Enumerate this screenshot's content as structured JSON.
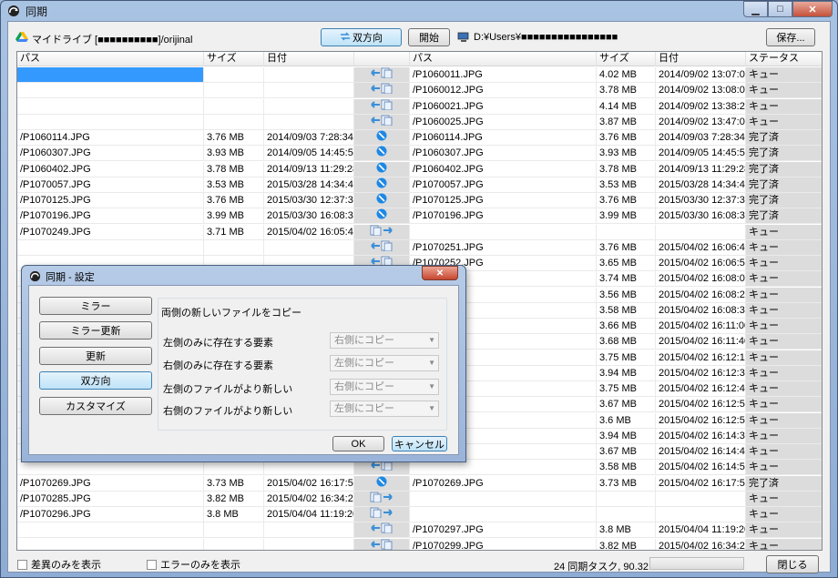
{
  "window": {
    "title": "同期",
    "min_label": "▁",
    "max_label": "□",
    "close_label": "✕"
  },
  "toolbar": {
    "left_path": "マイドライブ [■■■■■■■■■■]/orijinal",
    "direction_button": "双方向",
    "start_button": "開始",
    "right_path": "D:¥Users¥■■■■■■■■■■■■■■■■",
    "save_button": "保存..."
  },
  "columns": [
    "パス",
    "サイズ",
    "日付",
    "",
    "パス",
    "サイズ",
    "日付",
    "ステータス"
  ],
  "rows": [
    {
      "lp": "",
      "ls": "",
      "ld": "",
      "dir": "left",
      "rp": "/P1060011.JPG",
      "rs": "4.02 MB",
      "rd": "2014/09/02 13:07:02",
      "st": "キュー",
      "sel": true
    },
    {
      "lp": "",
      "ls": "",
      "ld": "",
      "dir": "left",
      "rp": "/P1060012.JPG",
      "rs": "3.78 MB",
      "rd": "2014/09/02 13:08:02",
      "st": "キュー"
    },
    {
      "lp": "",
      "ls": "",
      "ld": "",
      "dir": "left",
      "rp": "/P1060021.JPG",
      "rs": "4.14 MB",
      "rd": "2014/09/02 13:38:26",
      "st": "キュー"
    },
    {
      "lp": "",
      "ls": "",
      "ld": "",
      "dir": "left",
      "rp": "/P1060025.JPG",
      "rs": "3.87 MB",
      "rd": "2014/09/02 13:47:04",
      "st": "キュー"
    },
    {
      "lp": "/P1060114.JPG",
      "ls": "3.76 MB",
      "ld": "2014/09/03 7:28:34",
      "dir": "equal",
      "rp": "/P1060114.JPG",
      "rs": "3.76 MB",
      "rd": "2014/09/03 7:28:34",
      "st": "完了済"
    },
    {
      "lp": "/P1060307.JPG",
      "ls": "3.93 MB",
      "ld": "2014/09/05 14:45:56",
      "dir": "equal",
      "rp": "/P1060307.JPG",
      "rs": "3.93 MB",
      "rd": "2014/09/05 14:45:56",
      "st": "完了済"
    },
    {
      "lp": "/P1060402.JPG",
      "ls": "3.78 MB",
      "ld": "2014/09/13 11:29:28",
      "dir": "equal",
      "rp": "/P1060402.JPG",
      "rs": "3.78 MB",
      "rd": "2014/09/13 11:29:28",
      "st": "完了済"
    },
    {
      "lp": "/P1070057.JPG",
      "ls": "3.53 MB",
      "ld": "2015/03/28 14:34:40",
      "dir": "equal",
      "rp": "/P1070057.JPG",
      "rs": "3.53 MB",
      "rd": "2015/03/28 14:34:40",
      "st": "完了済"
    },
    {
      "lp": "/P1070125.JPG",
      "ls": "3.76 MB",
      "ld": "2015/03/30 12:37:32",
      "dir": "equal",
      "rp": "/P1070125.JPG",
      "rs": "3.76 MB",
      "rd": "2015/03/30 12:37:32",
      "st": "完了済"
    },
    {
      "lp": "/P1070196.JPG",
      "ls": "3.99 MB",
      "ld": "2015/03/30 16:08:30",
      "dir": "equal",
      "rp": "/P1070196.JPG",
      "rs": "3.99 MB",
      "rd": "2015/03/30 16:08:30",
      "st": "完了済"
    },
    {
      "lp": "/P1070249.JPG",
      "ls": "3.71 MB",
      "ld": "2015/04/02 16:05:40",
      "dir": "right",
      "rp": "",
      "rs": "",
      "rd": "",
      "st": "キュー"
    },
    {
      "lp": "",
      "ls": "",
      "ld": "",
      "dir": "left",
      "rp": "/P1070251.JPG",
      "rs": "3.76 MB",
      "rd": "2015/04/02 16:06:48",
      "st": "キュー"
    },
    {
      "lp": "",
      "ls": "",
      "ld": "",
      "dir": "left",
      "rp": "/P1070252.JPG",
      "rs": "3.65 MB",
      "rd": "2015/04/02 16:06:54",
      "st": "キュー"
    },
    {
      "lp": "",
      "ls": "",
      "ld": "",
      "dir": "left",
      "rp": "",
      "rs": "3.74 MB",
      "rd": "2015/04/02 16:08:00",
      "st": "キュー"
    },
    {
      "lp": "",
      "ls": "",
      "ld": "",
      "dir": "left",
      "rp": "",
      "rs": "3.56 MB",
      "rd": "2015/04/02 16:08:28",
      "st": "キュー"
    },
    {
      "lp": "",
      "ls": "",
      "ld": "",
      "dir": "left",
      "rp": "",
      "rs": "3.58 MB",
      "rd": "2015/04/02 16:08:34",
      "st": "キュー"
    },
    {
      "lp": "",
      "ls": "",
      "ld": "",
      "dir": "left",
      "rp": "",
      "rs": "3.66 MB",
      "rd": "2015/04/02 16:11:00",
      "st": "キュー"
    },
    {
      "lp": "",
      "ls": "",
      "ld": "",
      "dir": "left",
      "rp": "",
      "rs": "3.68 MB",
      "rd": "2015/04/02 16:11:40",
      "st": "キュー"
    },
    {
      "lp": "",
      "ls": "",
      "ld": "",
      "dir": "left",
      "rp": "",
      "rs": "3.75 MB",
      "rd": "2015/04/02 16:12:14",
      "st": "キュー"
    },
    {
      "lp": "",
      "ls": "",
      "ld": "",
      "dir": "left",
      "rp": "",
      "rs": "3.94 MB",
      "rd": "2015/04/02 16:12:36",
      "st": "キュー"
    },
    {
      "lp": "",
      "ls": "",
      "ld": "",
      "dir": "left",
      "rp": "",
      "rs": "3.75 MB",
      "rd": "2015/04/02 16:12:44",
      "st": "キュー"
    },
    {
      "lp": "",
      "ls": "",
      "ld": "",
      "dir": "left",
      "rp": "",
      "rs": "3.67 MB",
      "rd": "2015/04/02 16:12:54",
      "st": "キュー"
    },
    {
      "lp": "",
      "ls": "",
      "ld": "",
      "dir": "left",
      "rp": "",
      "rs": "3.6 MB",
      "rd": "2015/04/02 16:12:58",
      "st": "キュー"
    },
    {
      "lp": "",
      "ls": "",
      "ld": "",
      "dir": "left",
      "rp": "",
      "rs": "3.94 MB",
      "rd": "2015/04/02 16:14:34",
      "st": "キュー"
    },
    {
      "lp": "",
      "ls": "",
      "ld": "",
      "dir": "left",
      "rp": "",
      "rs": "3.67 MB",
      "rd": "2015/04/02 16:14:46",
      "st": "キュー"
    },
    {
      "lp": "",
      "ls": "",
      "ld": "",
      "dir": "left",
      "rp": "",
      "rs": "3.58 MB",
      "rd": "2015/04/02 16:14:52",
      "st": "キュー"
    },
    {
      "lp": "/P1070269.JPG",
      "ls": "3.73 MB",
      "ld": "2015/04/02 16:17:50",
      "dir": "equal",
      "rp": "/P1070269.JPG",
      "rs": "3.73 MB",
      "rd": "2015/04/02 16:17:50",
      "st": "完了済"
    },
    {
      "lp": "/P1070285.JPG",
      "ls": "3.82 MB",
      "ld": "2015/04/02 16:34:26",
      "dir": "right",
      "rp": "",
      "rs": "",
      "rd": "",
      "st": "キュー"
    },
    {
      "lp": "/P1070296.JPG",
      "ls": "3.8 MB",
      "ld": "2015/04/04 11:19:20",
      "dir": "right",
      "rp": "",
      "rs": "",
      "rd": "",
      "st": "キュー"
    },
    {
      "lp": "",
      "ls": "",
      "ld": "",
      "dir": "left",
      "rp": "/P1070297.JPG",
      "rs": "3.8 MB",
      "rd": "2015/04/04 11:19:20",
      "st": "キュー"
    },
    {
      "lp": "",
      "ls": "",
      "ld": "",
      "dir": "left",
      "rp": "/P1070299.JPG",
      "rs": "3.82 MB",
      "rd": "2015/04/02 16:34:26",
      "st": "キュー"
    }
  ],
  "statusbar": {
    "diff_only": "差異のみを表示",
    "errors_only": "エラーのみを表示",
    "summary": "24 同期タスク, 90.32 MB",
    "close_button": "閉じる"
  },
  "dialog": {
    "title": "同期 - 設定",
    "close_label": "✕",
    "modes": [
      "ミラー",
      "ミラー更新",
      "更新",
      "双方向",
      "カスタマイズ"
    ],
    "selected_mode": "双方向",
    "group_label": "両側の新しいファイルをコピー",
    "rules": [
      {
        "label": "左側のみに存在する要素",
        "value": "右側にコピー"
      },
      {
        "label": "右側のみに存在する要素",
        "value": "左側にコピー"
      },
      {
        "label": "左側のファイルがより新しい",
        "value": "右側にコピー"
      },
      {
        "label": "右側のファイルがより新しい",
        "value": "左側にコピー"
      }
    ],
    "ok_button": "OK",
    "cancel_button": "キャンセル"
  },
  "colors": {
    "selection": "#3399ff",
    "equal_icon": "#1e88e5",
    "arrow": "#3a8fd8"
  }
}
